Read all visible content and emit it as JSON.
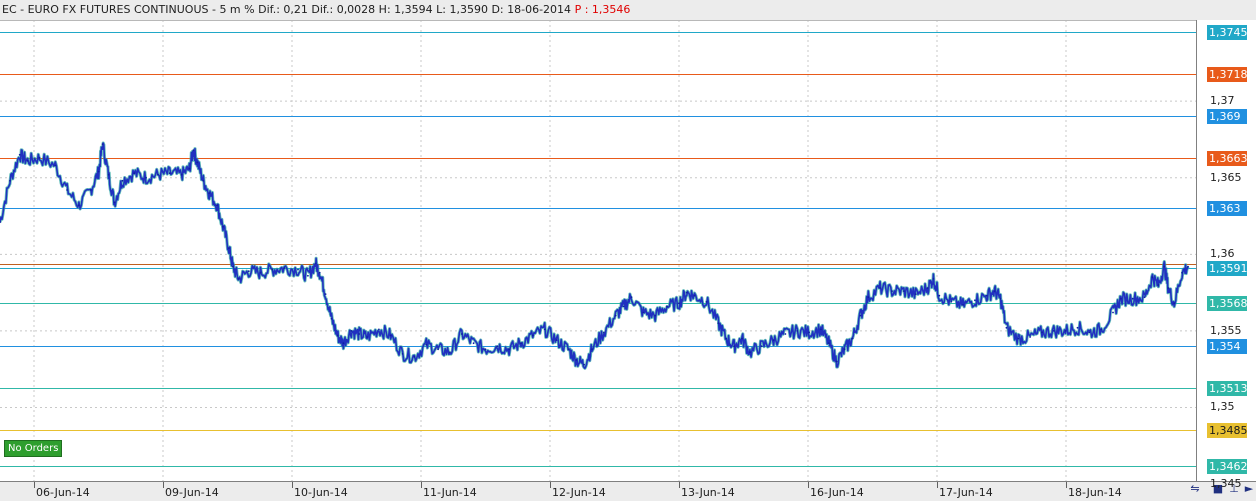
{
  "title": {
    "symbol": "EC - EURO FX FUTURES CONTINUOUS - 5 m",
    "stats": "% Dif.: 0,21  Dif.: 0,0028  H: 1,3594  L: 1,3590  D: 18-06-2014",
    "price": "P : 1,3546"
  },
  "badge": {
    "label": "No Orders",
    "color": "#2e9e2e"
  },
  "toolbar_icons": [
    "chart-style-icon",
    "save-icon",
    "pin-icon",
    "scroll-right-icon"
  ],
  "chart_data": {
    "type": "line",
    "title": "",
    "xlabel": "",
    "ylabel": "",
    "ylim": [
      1.3452,
      1.3753
    ],
    "grid": true,
    "x_ticks": [
      "06-Jun-14",
      "09-Jun-14",
      "10-Jun-14",
      "11-Jun-14",
      "12-Jun-14",
      "13-Jun-14",
      "16-Jun-14",
      "17-Jun-14",
      "18-Jun-14"
    ],
    "y_ticks": [
      "1,345",
      "1,35",
      "1,355",
      "1,36",
      "1,365",
      "1,37"
    ],
    "y_tick_values": [
      1.345,
      1.35,
      1.355,
      1.36,
      1.365,
      1.37
    ],
    "levels": [
      {
        "value": 1.3745,
        "label": "1,3745",
        "color": "#20a8c8"
      },
      {
        "value": 1.3718,
        "label": "1,3718",
        "color": "#e85a1a"
      },
      {
        "value": 1.369,
        "label": "1,369",
        "color": "#2090e0"
      },
      {
        "value": 1.3663,
        "label": "1,3663",
        "color": "#e85a1a"
      },
      {
        "value": 1.363,
        "label": "1,363",
        "color": "#2090e0"
      },
      {
        "value": 1.3591,
        "label": "1,3591",
        "color": "#20a8c8"
      },
      {
        "value": 1.3568,
        "label": "1,3568",
        "color": "#30b8a8"
      },
      {
        "value": 1.354,
        "label": "1,354",
        "color": "#2090e0"
      },
      {
        "value": 1.3513,
        "label": "1,3513",
        "color": "#30b8a8"
      },
      {
        "value": 1.3485,
        "label": "1,3485",
        "color": "#e8c030"
      },
      {
        "value": 1.3462,
        "label": "1,3462",
        "color": "#30b8a8"
      }
    ],
    "current_price": 1.3594,
    "current_line_color": "#c06020",
    "series": [
      {
        "color": "#2030c0",
        "points": [
          [
            0,
            1.3621
          ],
          [
            0.25,
            1.3648
          ],
          [
            0.5,
            1.3665
          ],
          [
            0.7,
            1.3661
          ],
          [
            1,
            1.3663
          ],
          [
            1.4,
            1.3658
          ],
          [
            1.7,
            1.3642
          ],
          [
            2,
            1.3632
          ],
          [
            2.3,
            1.3642
          ],
          [
            2.5,
            1.3654
          ],
          [
            2.6,
            1.3672
          ],
          [
            2.75,
            1.3652
          ],
          [
            2.9,
            1.3634
          ],
          [
            3.1,
            1.3648
          ],
          [
            3.4,
            1.3653
          ],
          [
            3.7,
            1.365
          ],
          [
            4,
            1.3652
          ],
          [
            4.3,
            1.3653
          ],
          [
            4.6,
            1.3652
          ],
          [
            4.8,
            1.3656
          ],
          [
            4.9,
            1.3668
          ],
          [
            5,
            1.366
          ],
          [
            5.15,
            1.3648
          ],
          [
            5.3,
            1.364
          ],
          [
            5.5,
            1.3632
          ],
          [
            5.65,
            1.3618
          ],
          [
            5.8,
            1.3604
          ],
          [
            5.9,
            1.3592
          ],
          [
            6.05,
            1.3584
          ],
          [
            6.3,
            1.3589
          ],
          [
            6.6,
            1.3588
          ],
          [
            6.9,
            1.359
          ],
          [
            7.2,
            1.3591
          ],
          [
            7.55,
            1.359
          ],
          [
            7.8,
            1.3586
          ],
          [
            8,
            1.3594
          ],
          [
            8.1,
            1.3588
          ],
          [
            8.25,
            1.3574
          ],
          [
            8.4,
            1.3558
          ],
          [
            8.55,
            1.3547
          ],
          [
            8.7,
            1.3542
          ],
          [
            8.9,
            1.355
          ],
          [
            9.1,
            1.3548
          ],
          [
            9.3,
            1.3546
          ],
          [
            9.6,
            1.3551
          ],
          [
            9.9,
            1.3547
          ],
          [
            10.2,
            1.3535
          ],
          [
            10.5,
            1.3533
          ],
          [
            10.8,
            1.3541
          ],
          [
            11.1,
            1.3538
          ],
          [
            11.4,
            1.3536
          ],
          [
            11.7,
            1.3548
          ],
          [
            12,
            1.3542
          ],
          [
            12.3,
            1.3538
          ],
          [
            12.6,
            1.354
          ],
          [
            12.9,
            1.3538
          ],
          [
            13.2,
            1.3542
          ],
          [
            13.5,
            1.3547
          ],
          [
            13.8,
            1.3551
          ],
          [
            14.1,
            1.3544
          ],
          [
            14.4,
            1.3538
          ],
          [
            14.6,
            1.3531
          ],
          [
            14.8,
            1.3528
          ],
          [
            15,
            1.3538
          ],
          [
            15.3,
            1.3549
          ],
          [
            15.6,
            1.356
          ],
          [
            15.8,
            1.3566
          ],
          [
            16,
            1.3572
          ],
          [
            16.3,
            1.3562
          ],
          [
            16.6,
            1.356
          ],
          [
            16.9,
            1.3566
          ],
          [
            17.2,
            1.3568
          ],
          [
            17.4,
            1.3575
          ],
          [
            17.6,
            1.3573
          ],
          [
            17.9,
            1.3569
          ],
          [
            18.2,
            1.3555
          ],
          [
            18.4,
            1.3545
          ],
          [
            18.6,
            1.354
          ],
          [
            18.8,
            1.3545
          ],
          [
            19,
            1.3536
          ],
          [
            19.3,
            1.354
          ],
          [
            19.6,
            1.3544
          ],
          [
            19.9,
            1.3548
          ],
          [
            20.2,
            1.355
          ],
          [
            20.5,
            1.3549
          ],
          [
            20.8,
            1.3551
          ],
          [
            21,
            1.3542
          ],
          [
            21.2,
            1.353
          ],
          [
            21.4,
            1.3538
          ],
          [
            21.6,
            1.3545
          ],
          [
            21.8,
            1.356
          ],
          [
            22,
            1.3572
          ],
          [
            22.3,
            1.3578
          ],
          [
            22.6,
            1.3576
          ],
          [
            22.9,
            1.3576
          ],
          [
            23.2,
            1.3574
          ],
          [
            23.5,
            1.3578
          ],
          [
            23.65,
            1.3584
          ],
          [
            23.8,
            1.3573
          ],
          [
            24.1,
            1.3569
          ],
          [
            24.4,
            1.3567
          ],
          [
            24.7,
            1.357
          ],
          [
            25,
            1.3573
          ],
          [
            25.2,
            1.3576
          ],
          [
            25.35,
            1.3571
          ],
          [
            25.5,
            1.3552
          ],
          [
            25.8,
            1.3545
          ],
          [
            26.1,
            1.3546
          ],
          [
            26.4,
            1.3549
          ],
          [
            26.7,
            1.355
          ],
          [
            27,
            1.355
          ],
          [
            27.3,
            1.3552
          ],
          [
            27.6,
            1.3549
          ],
          [
            27.9,
            1.3551
          ],
          [
            28.2,
            1.3562
          ],
          [
            28.4,
            1.3571
          ],
          [
            28.7,
            1.3571
          ],
          [
            29,
            1.3572
          ],
          [
            29.2,
            1.3585
          ],
          [
            29.35,
            1.358
          ],
          [
            29.5,
            1.3592
          ],
          [
            29.6,
            1.3578
          ],
          [
            29.75,
            1.3568
          ],
          [
            29.95,
            1.3588
          ],
          [
            30.1,
            1.3592
          ]
        ]
      }
    ]
  }
}
